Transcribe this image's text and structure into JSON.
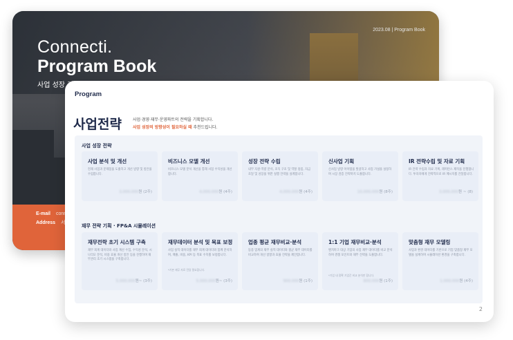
{
  "cover": {
    "date": "2023.08 | Program Book",
    "title_line1": "Connecti.",
    "title_line2": "Program Book",
    "subtitle": "사업 성장 가",
    "contact": [
      {
        "label": "E-mail",
        "value": "conn"
      },
      {
        "label": "Address",
        "value": "서"
      }
    ],
    "accent_color": "#e0643a"
  },
  "front": {
    "header": "Program",
    "title": "사업전략",
    "desc_line1": "사업·경영·재무·운영파트의 전략을 기획합니다.",
    "desc_line2_highlight": "사업 성장의 방향성이 필요하실 때",
    "desc_line2_rest": " 추천드립니다.",
    "page_number": "2",
    "sections": [
      {
        "title": "사업 성장 전략",
        "cards": [
          {
            "title": "사업 분석 및 개선",
            "desc": "현재 사업과 문제점을 도출하고 개선 방향 및 방안을 수립합니다.",
            "note": "",
            "price": "3,000,000",
            "suffix": "원 (2주)"
          },
          {
            "title": "비즈니스 모델 개선",
            "desc": "비즈니스 모델 분석 개선을 통해 사업 수익성을 개선합니다.",
            "note": "",
            "price": "4,000,000",
            "suffix": "원 (4주)"
          },
          {
            "title": "성장 전략 수립",
            "desc": "내부 자원·역량 분석, 조직 구조 및 역할 정립, 자금 조달 및 성장을 위한 실행 전략을 설계합니다.",
            "note": "",
            "price": "4,000,000",
            "suffix": "원 (4주)"
          },
          {
            "title": "신사업 기획",
            "desc": "신사업 방향 아이템을 발굴하고 사업 가설을 설정하며 시장 검증 전략까지 도출합니다.",
            "note": "",
            "price": "10,000,000",
            "suffix": "원 (8주)"
          },
          {
            "title": "IR 전략수립 및 자료 기획",
            "desc": "IR 전략 수립과 자료 기획, 레퍼런스 제작을 진행합니다. 투자자에게 전략적으로 IR 메시지를 전달합니다.",
            "note": "",
            "price": "3,000,000",
            "suffix": "원 ~ (8)"
          }
        ]
      },
      {
        "title": "재무 전략 기획 · FP&A 시뮬레이션",
        "cards": [
          {
            "title": "재무전략 초기 시스템 구축",
            "desc": "재무 회계 데이터와 사업 계산 수집, 수익성 분석, 시나리오 분석, 비용 효율 개선 방안 등을 진행하며 재무관리 초기 시스템을 구축합니다.",
            "note": "",
            "price": "5,000,000",
            "suffix": "원~ (3주)"
          },
          {
            "title": "재무데이터 분석 및 목표 보정",
            "desc": "사업 실적 데이터를 재무 회계 데이터와 함께 분석하여, 매출, 비용, KPI 등 목표 수치를 보정합니다.",
            "note": "*기본 재무 자료 전달 필요합니다.",
            "price": "5,000,000",
            "suffix": "원~ (3주)"
          },
          {
            "title": "업종 평균 재무비교·분석",
            "desc": "동종 업계의 재무 실적 데이터와 평균 재무 데이터를 비교하여 개선 방향과 효율 전략을 제안합니다.",
            "note": "",
            "price": "900,000",
            "suffix": "원 (1주)"
          },
          {
            "title": "1:1 기업 재무비교·분석",
            "desc": "벤치마크 대상 기업의 사업 재무 데이터를 비교 분석하여 경쟁 포인트와 재무 전략을 도출합니다.",
            "note": "*기업 내 정확 기업간 비교 분석만 합니다.",
            "price": "800,000",
            "suffix": "원 (1주)"
          },
          {
            "title": "맞춤형 재무 모델링",
            "desc": "사업과 환경 데이터를 기반으로 기업 맞춤형 재무 모델을 설계하며 시뮬레이션 환경을 구축합니다.",
            "note": "",
            "price": "1,000,000",
            "suffix": "원 (4주)"
          }
        ]
      }
    ]
  }
}
